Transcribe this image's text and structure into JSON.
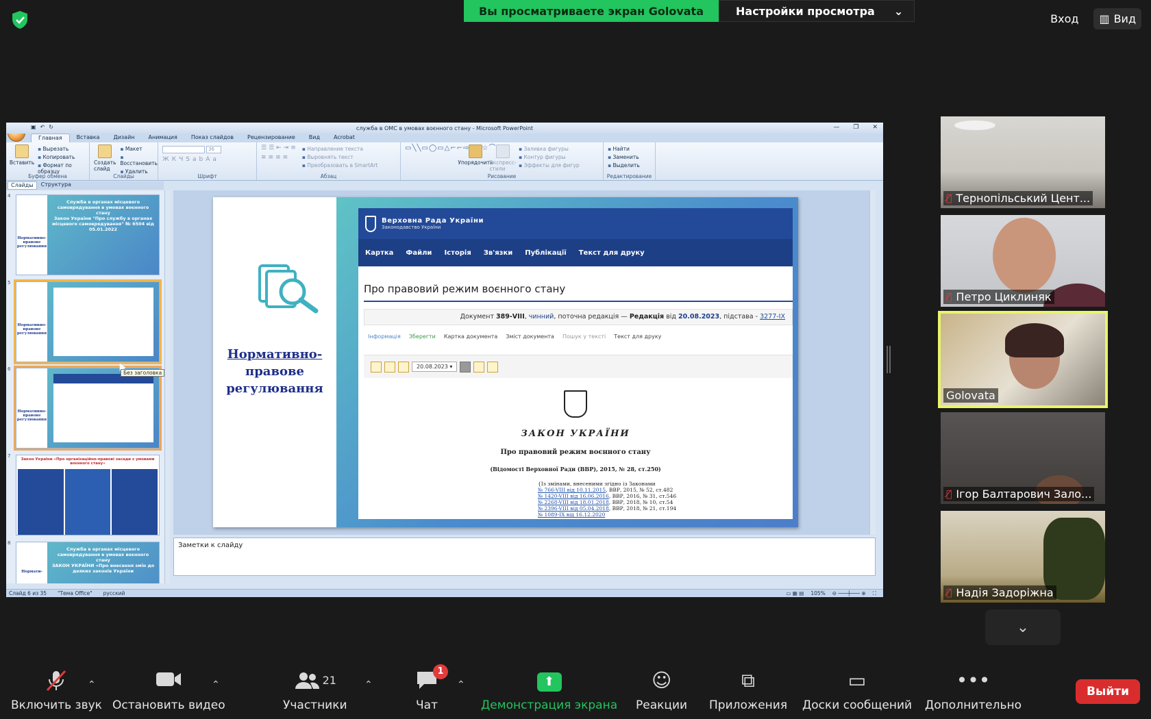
{
  "zoom": {
    "share_banner": "Вы просматриваете экран Golovata",
    "view_options": "Настройки просмотра",
    "enter_btn": "Вход",
    "view_btn": "Вид"
  },
  "ppt": {
    "window_title": "служба в ОМС в умовах воєнного стану - Microsoft PowerPoint",
    "tabs": [
      "Главная",
      "Вставка",
      "Дизайн",
      "Анимация",
      "Показ слайдов",
      "Рецензирование",
      "Вид",
      "Acrobat"
    ],
    "ribbon": {
      "paste": "Вставить",
      "cut": "Вырезать",
      "copy": "Копировать",
      "format_painter": "Формат по образцу",
      "clipboard": "Буфер обмена",
      "new_slide": "Создать слайд",
      "layout": "Макет",
      "reset": "Восстановить",
      "delete": "Удалить",
      "slides": "Слайды",
      "font_size": "36",
      "font": "Шрифт",
      "text_direction": "Направление текста",
      "align_text": "Выровнять текст",
      "smartart": "Преобразовать в SmartArt",
      "paragraph": "Абзац",
      "arrange": "Упорядочить",
      "express_styles": "Экспресс-стили",
      "fill": "Заливка фигуры",
      "outline": "Контур фигуры",
      "effects": "Эффекты для фигур",
      "drawing": "Рисование",
      "find": "Найти",
      "replace": "Заменить",
      "select": "Выделить",
      "editing": "Редактирование"
    },
    "pane_tabs": [
      "Слайды",
      "Структура"
    ],
    "thumbs": [
      {
        "num": "4",
        "left": "Нормативно-правове регулювання",
        "right": "Служба в органах місцевого самоврядування в умовах воєнного стану\nЗакон України \"Про службу в органах місцевого самоврядування\" № 6504 від 05.01.2022"
      },
      {
        "num": "5",
        "left": "Нормативно-правове регулювання",
        "right": ""
      },
      {
        "num": "6",
        "left": "Нормативно-правове регулювання",
        "right": ""
      },
      {
        "num": "7",
        "left": "",
        "right": "Закон України «Про організаційно-правові засади з умовами воєнного стану»"
      },
      {
        "num": "8",
        "left": "Нормати-",
        "right": "Служба в органах місцевого самоврядування в умовах воєнного стану\nЗАКОН УКРАЇНИ «Про внесення змін до деяких законів України"
      }
    ],
    "tooltip": "Без заголовка",
    "slide": {
      "heading_l1": "Нормативно-",
      "heading_l2": "правове",
      "heading_l3": "регулювання",
      "web": {
        "site_title": "Верховна Рада України",
        "site_sub": "Законодавство України",
        "nav": [
          "Картка",
          "Файли",
          "Історія",
          "Зв'язки",
          "Публікації",
          "Текст для друку"
        ],
        "page_title": "Про правовий режим воєнного стану",
        "doc_prefix": "Документ",
        "doc_num": "389-VIII",
        "doc_status": "чинний",
        "doc_mid": ", поточна редакція —",
        "doc_red": "Редакція",
        "doc_from": "від",
        "doc_date": "20.08.2023",
        "doc_basis": ", підстава -",
        "doc_link": "3277-IX",
        "actions": [
          "Інформація",
          "Зберегти",
          "Картка документа",
          "Зміст документа",
          "Пошук у тексті",
          "Текст для друку"
        ],
        "date_select": "20.08.2023",
        "law_type": "ЗАКОН УКРАЇНИ",
        "law_name": "Про правовий режим воєнного стану",
        "law_source": "(Відомості Верховної Ради (ВВР), 2015, № 28, ст.250)",
        "amend_intro": "{Із змінами, внесеними згідно із Законами",
        "amends": [
          {
            "link": "№ 766-VIII від 10.11.2015",
            "rest": ", ВВР, 2015, № 52, ст.482"
          },
          {
            "link": "№ 1420-VIII від 16.06.2016",
            "rest": ", ВВР, 2016, № 31, ст.546"
          },
          {
            "link": "№ 2268-VIII від 18.01.2018",
            "rest": ", ВВР, 2018, № 10, ст.54"
          },
          {
            "link": "№ 2396-VIII від 05.04.2018",
            "rest": ", ВВР, 2018, № 21, ст.194"
          },
          {
            "link": "№ 1089-IX від 16.12.2020",
            "rest": ""
          }
        ]
      }
    },
    "notes": "Заметки к слайду",
    "status": {
      "slide": "Слайд 6 из 35",
      "theme": "\"Тема Office\"",
      "lang": "русский",
      "zoom": "105%"
    }
  },
  "participants": [
    {
      "name": "Тернопільський Цент...",
      "muted": true
    },
    {
      "name": "Петро Циклиняк",
      "muted": true
    },
    {
      "name": "Golovata",
      "muted": false
    },
    {
      "name": "Ігор Балтарович Зало...",
      "muted": true
    },
    {
      "name": "Надія Задорiжна",
      "muted": true
    }
  ],
  "toolbar": {
    "mute": "Включить звук",
    "video": "Остановить видео",
    "participants": "Участники",
    "participants_count": "21",
    "chat": "Чат",
    "chat_badge": "1",
    "share": "Демонстрация экрана",
    "reactions": "Реакции",
    "apps": "Приложения",
    "whiteboards": "Доски сообщений",
    "more": "Дополнительно",
    "leave": "Выйти"
  },
  "colors": {
    "share_green": "#22c55e",
    "leave_red": "#d92d2d",
    "active_speaker": "#e8f56a",
    "vru_blue": "#234a98"
  }
}
